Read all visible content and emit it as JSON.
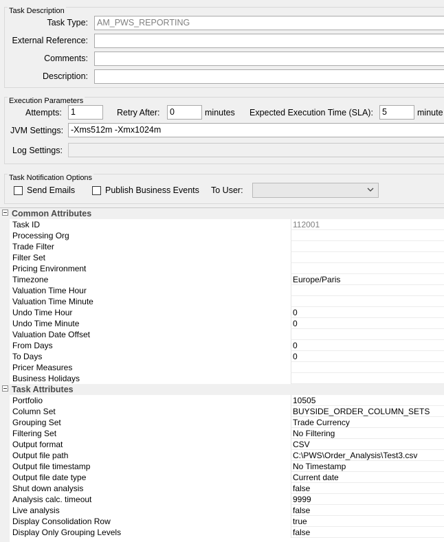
{
  "task_description": {
    "legend": "Task Description",
    "task_type_label": "Task Type:",
    "task_type_value": "AM_PWS_REPORTING",
    "external_reference_label": "External Reference:",
    "external_reference_value": "",
    "comments_label": "Comments:",
    "comments_value": "",
    "description_label": "Description:",
    "description_value": ""
  },
  "execution_parameters": {
    "legend": "Execution Parameters",
    "attempts_label": "Attempts:",
    "attempts_value": "1",
    "retry_after_label": "Retry After:",
    "retry_after_value": "0",
    "retry_unit": "minutes",
    "sla_label": "Expected Execution Time (SLA):",
    "sla_value": "5",
    "sla_unit": "minute",
    "jvm_label": "JVM Settings:",
    "jvm_value": "-Xms512m -Xmx1024m",
    "log_label": "Log Settings:",
    "log_value": ""
  },
  "notification": {
    "legend": "Task Notification Options",
    "send_emails_label": "Send Emails",
    "send_emails_checked": false,
    "publish_events_label": "Publish Business Events",
    "publish_events_checked": false,
    "to_user_label": "To User:",
    "to_user_value": ""
  },
  "property_sheet": {
    "sections": [
      {
        "title": "Common Attributes",
        "rows": [
          {
            "name": "Task ID",
            "value": "112001",
            "readonly": true
          },
          {
            "name": "Processing Org",
            "value": ""
          },
          {
            "name": "Trade Filter",
            "value": ""
          },
          {
            "name": "Filter Set",
            "value": ""
          },
          {
            "name": "Pricing Environment",
            "value": ""
          },
          {
            "name": "Timezone",
            "value": "Europe/Paris"
          },
          {
            "name": "Valuation Time Hour",
            "value": ""
          },
          {
            "name": "Valuation Time Minute",
            "value": ""
          },
          {
            "name": "Undo Time Hour",
            "value": "0"
          },
          {
            "name": "Undo Time Minute",
            "value": "0"
          },
          {
            "name": "Valuation Date Offset",
            "value": ""
          },
          {
            "name": "From Days",
            "value": "0"
          },
          {
            "name": "To Days",
            "value": "0"
          },
          {
            "name": "Pricer Measures",
            "value": ""
          },
          {
            "name": "Business Holidays",
            "value": ""
          }
        ]
      },
      {
        "title": "Task Attributes",
        "rows": [
          {
            "name": "Portfolio",
            "value": "10505"
          },
          {
            "name": "Column Set",
            "value": "BUYSIDE_ORDER_COLUMN_SETS"
          },
          {
            "name": "Grouping Set",
            "value": "Trade Currency"
          },
          {
            "name": "Filtering Set",
            "value": "No Filtering"
          },
          {
            "name": "Output format",
            "value": "CSV"
          },
          {
            "name": "Output file path",
            "value": "C:\\PWS\\Order_Analysis\\Test3.csv"
          },
          {
            "name": "Output file timestamp",
            "value": "No Timestamp"
          },
          {
            "name": "Output file date type",
            "value": "Current date"
          },
          {
            "name": "Shut down analysis",
            "value": "false"
          },
          {
            "name": "Analysis calc. timeout",
            "value": "9999"
          },
          {
            "name": "Live analysis",
            "value": "false"
          },
          {
            "name": "Display Consolidation Row",
            "value": "true"
          },
          {
            "name": "Display Only Grouping Levels",
            "value": "false"
          }
        ]
      }
    ]
  }
}
